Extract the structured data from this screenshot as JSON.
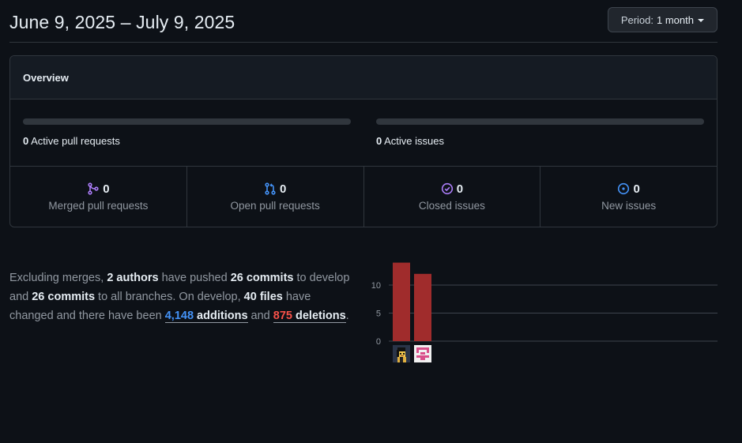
{
  "header": {
    "date_range": "June 9, 2025 – July 9, 2025",
    "period_prefix": "Period:",
    "period_value": "1 month"
  },
  "overview": {
    "title": "Overview",
    "active_prs_count": "0",
    "active_prs_label": "Active pull requests",
    "active_prs_progress": 0,
    "active_issues_count": "0",
    "active_issues_label": "Active issues",
    "active_issues_progress": 0,
    "stats": [
      {
        "icon": "git-merge-icon",
        "color": "#ab7df8",
        "value": "0",
        "label": "Merged pull requests"
      },
      {
        "icon": "git-pull-request-icon",
        "color": "#4493f8",
        "value": "0",
        "label": "Open pull requests"
      },
      {
        "icon": "issue-closed-icon",
        "color": "#ab7df8",
        "value": "0",
        "label": "Closed issues"
      },
      {
        "icon": "issue-opened-icon",
        "color": "#4493f8",
        "value": "0",
        "label": "New issues"
      }
    ]
  },
  "summary": {
    "p1": "Excluding merges, ",
    "authors": "2 authors",
    "p2": " have pushed ",
    "commits_branch": "26 commits",
    "p3": " to develop and ",
    "commits_all": "26 commits",
    "p4": " to all branches. On develop, ",
    "files": "40 files",
    "p5": " have changed and there have been ",
    "additions_num": "4,148",
    "additions_word": " additions",
    "p6": " and ",
    "deletions_num": "875",
    "deletions_word": " deletions",
    "p7": "."
  },
  "chart_data": {
    "type": "bar",
    "categories": [
      "author-1",
      "author-2"
    ],
    "values": [
      14,
      12
    ],
    "ylim": [
      0,
      14
    ],
    "yticks": [
      "0",
      "5",
      "10"
    ],
    "bar_color": "#a02c2c",
    "grid": true
  },
  "colors": {
    "background": "#0d1117",
    "border": "#30363d",
    "accent_blue": "#4493f8",
    "accent_purple": "#ab7df8",
    "deletion_red": "#f85149"
  }
}
